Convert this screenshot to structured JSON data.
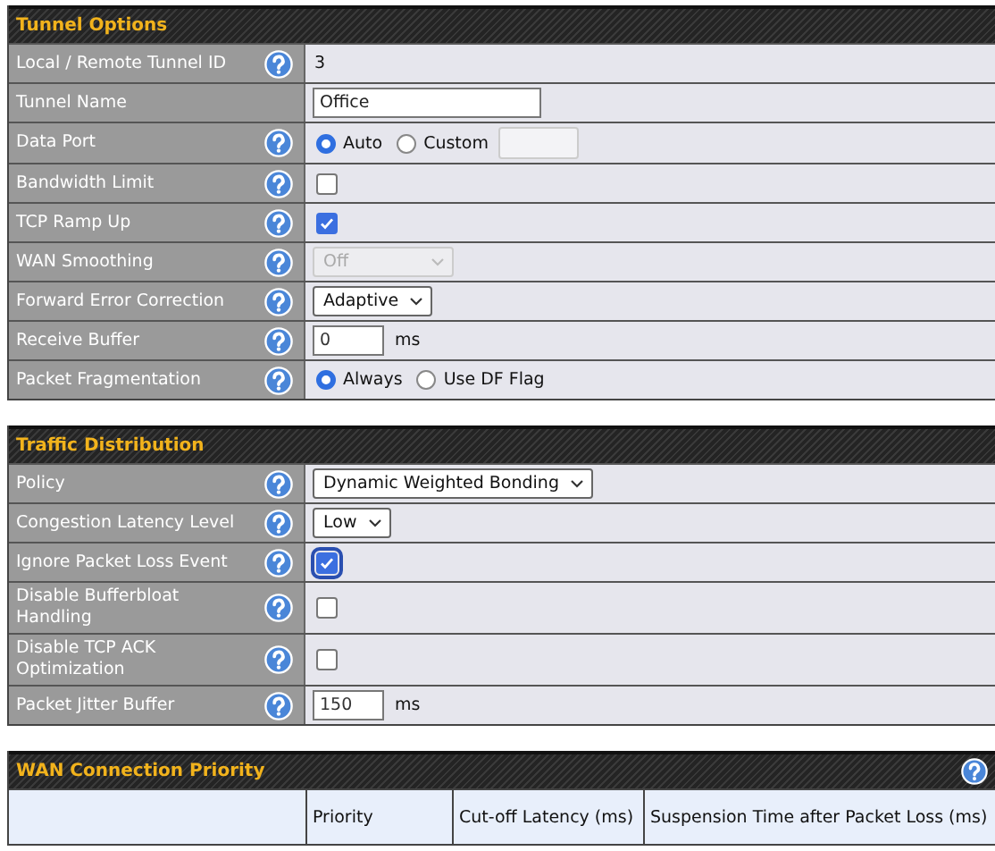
{
  "sections": [
    {
      "title": "Tunnel Options",
      "help": false,
      "rows": [
        {
          "label": "Local / Remote Tunnel ID",
          "help": true,
          "kind": "text",
          "value": "3"
        },
        {
          "label": "Tunnel Name",
          "help": false,
          "kind": "input",
          "value": "Office"
        },
        {
          "label": "Data Port",
          "help": true,
          "kind": "radio",
          "options": [
            {
              "label": "Auto",
              "selected": true,
              "field": false
            },
            {
              "label": "Custom",
              "selected": false,
              "field": true
            }
          ]
        },
        {
          "label": "Bandwidth Limit",
          "help": true,
          "kind": "checkbox",
          "checked": false
        },
        {
          "label": "TCP Ramp Up",
          "help": true,
          "kind": "checkbox",
          "checked": true
        },
        {
          "label": "WAN Smoothing",
          "help": true,
          "kind": "select",
          "value": "Off",
          "disabled": true
        },
        {
          "label": "Forward Error Correction",
          "help": true,
          "kind": "select",
          "value": "Adaptive",
          "disabled": false
        },
        {
          "label": "Receive Buffer",
          "help": true,
          "kind": "number",
          "value": "0",
          "unit": "ms"
        },
        {
          "label": "Packet Fragmentation",
          "help": true,
          "kind": "radio",
          "options": [
            {
              "label": "Always",
              "selected": true,
              "field": false
            },
            {
              "label": "Use DF Flag",
              "selected": false,
              "field": false
            }
          ]
        }
      ]
    },
    {
      "title": "Traffic Distribution",
      "help": false,
      "rows": [
        {
          "label": "Policy",
          "help": true,
          "kind": "select",
          "value": "Dynamic Weighted Bonding",
          "disabled": false
        },
        {
          "label": "Congestion Latency Level",
          "help": true,
          "kind": "select",
          "value": "Low",
          "disabled": false
        },
        {
          "label": "Ignore Packet Loss Event",
          "help": true,
          "kind": "checkbox",
          "checked": true,
          "focused": true
        },
        {
          "label": "Disable Bufferbloat Handling",
          "help": true,
          "kind": "checkbox",
          "checked": false
        },
        {
          "label": "Disable TCP ACK Optimization",
          "help": true,
          "kind": "checkbox",
          "checked": false
        },
        {
          "label": "Packet Jitter Buffer",
          "help": true,
          "kind": "number",
          "value": "150",
          "unit": "ms"
        }
      ]
    },
    {
      "title": "WAN Connection Priority",
      "help": true,
      "columns": [
        "Priority",
        "Cut-off Latency (ms)",
        "Suspension Time after Packet Loss (ms)"
      ]
    }
  ]
}
